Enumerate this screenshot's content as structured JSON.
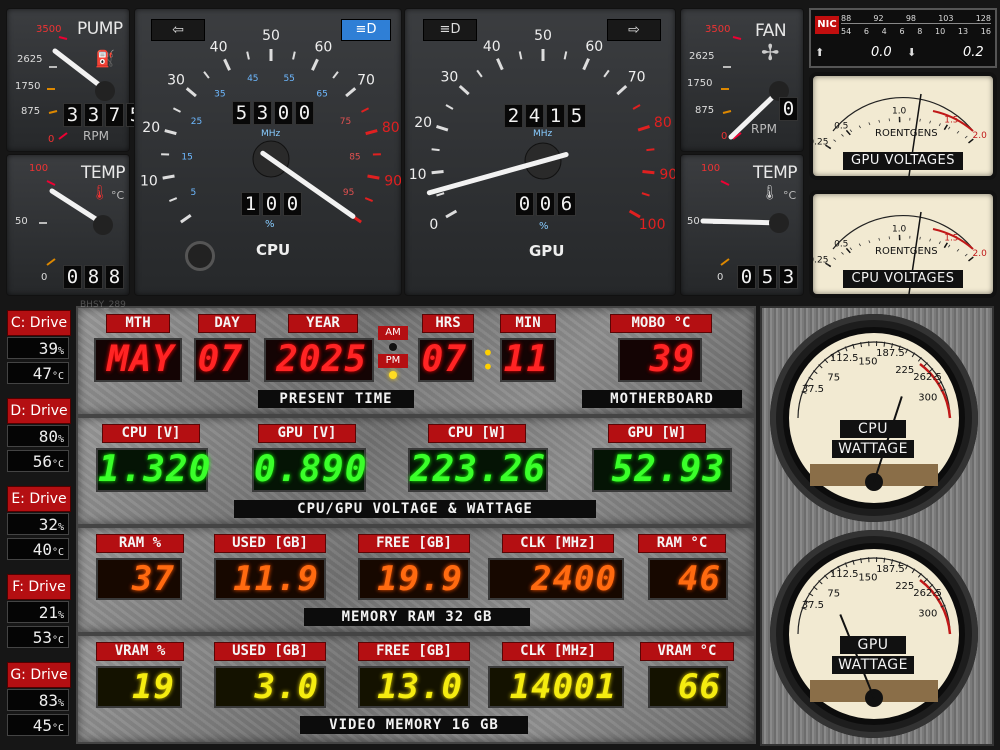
{
  "pump": {
    "title": "PUMP",
    "ticks": [
      "3500",
      "2625",
      "1750",
      "875",
      "0"
    ],
    "value": "3375",
    "unit": "RPM"
  },
  "temp_left": {
    "title": "TEMP",
    "ticks": [
      "100",
      "50",
      "0"
    ],
    "value": "088",
    "unit": "°C"
  },
  "fan": {
    "title": "FAN",
    "ticks": [
      "3500",
      "2625",
      "1750",
      "875",
      "0"
    ],
    "value": "0",
    "unit": "RPM"
  },
  "temp_right": {
    "title": "TEMP",
    "ticks": [
      "100",
      "50",
      "0"
    ],
    "value": "053",
    "unit": "°C"
  },
  "cpu_gauge": {
    "label": "CPU",
    "clock": "5300",
    "clock_unit": "MHz",
    "load": "100",
    "load_unit": "%",
    "outer_ticks": [
      "10",
      "20",
      "30",
      "40",
      "50",
      "60",
      "70",
      "80",
      "90"
    ],
    "inner_ticks": [
      "5",
      "15",
      "25",
      "35",
      "45",
      "55",
      "65",
      "75",
      "85",
      "95"
    ]
  },
  "gpu_gauge": {
    "label": "GPU",
    "clock": "2415",
    "clock_unit": "MHz",
    "load": "006",
    "load_unit": "%",
    "ticks": [
      "0",
      "10",
      "20",
      "30",
      "40",
      "50",
      "60",
      "70",
      "80",
      "90",
      "100"
    ]
  },
  "nic": {
    "label": "NIC",
    "top_scale": [
      "88",
      "92",
      "98",
      "103",
      "128"
    ],
    "bottom_scale": [
      "54",
      "6",
      "4",
      "6",
      "8",
      "10",
      "13",
      "16"
    ],
    "up": "0.0",
    "down": "0.2"
  },
  "gpu_voltages": {
    "label": "GPU VOLTAGES",
    "unit": "ROENTGENS",
    "scale": [
      "0.25",
      "0.5",
      "1.0",
      "1.5",
      "2.0"
    ]
  },
  "cpu_voltages": {
    "label": "CPU VOLTAGES",
    "unit": "ROENTGENS",
    "scale": [
      "0.25",
      "0.5",
      "1.0",
      "1.5",
      "2.0"
    ]
  },
  "time": {
    "labels": {
      "mth": "MTH",
      "day": "DAY",
      "year": "YEAR",
      "hrs": "HRS",
      "min": "MIN",
      "mobo": "MOBO °C",
      "am": "AM",
      "pm": "PM"
    },
    "month": "MAY",
    "day": "07",
    "year": "2025",
    "hrs": "07",
    "min": "11",
    "mobo": "39",
    "banner": "PRESENT TIME",
    "banner2": "MOTHERBOARD"
  },
  "power": {
    "labels": {
      "cpu_v": "CPU [V]",
      "gpu_v": "GPU [V]",
      "cpu_w": "CPU [W]",
      "gpu_w": "GPU [W]"
    },
    "cpu_v": "1.320",
    "gpu_v": "0.890",
    "cpu_w": "223.26",
    "gpu_w": "52.93",
    "banner": "CPU/GPU VOLTAGE & WATTAGE"
  },
  "ram": {
    "labels": {
      "pct": "RAM %",
      "used": "USED [GB]",
      "free": "FREE [GB]",
      "clk": "CLK [MHz]",
      "temp": "RAM °C"
    },
    "pct": "37",
    "used": "11.9",
    "free": "19.9",
    "clk": "2400",
    "temp": "46",
    "banner": "MEMORY RAM 32 GB"
  },
  "vram": {
    "labels": {
      "pct": "VRAM %",
      "used": "USED [GB]",
      "free": "FREE [GB]",
      "clk": "CLK [MHz]",
      "temp": "VRAM °C"
    },
    "pct": "19",
    "used": "3.0",
    "free": "13.0",
    "clk": "14001",
    "temp": "66",
    "banner": "VIDEO MEMORY 16 GB"
  },
  "drives": [
    {
      "label": "C: Drive",
      "pct": "39",
      "temp": "47"
    },
    {
      "label": "D: Drive",
      "pct": "80",
      "temp": "56"
    },
    {
      "label": "E: Drive",
      "pct": "32",
      "temp": "40"
    },
    {
      "label": "F: Drive",
      "pct": "21",
      "temp": "53"
    },
    {
      "label": "G: Drive",
      "pct": "83",
      "temp": "45"
    }
  ],
  "drive_units": {
    "pct": "%",
    "temp": "°C"
  },
  "cpu_wattage": {
    "label1": "CPU",
    "label2": "WATTAGE",
    "scale": [
      "37.5",
      "75",
      "112.5",
      "150",
      "187.5",
      "225",
      "262.5",
      "300"
    ]
  },
  "gpu_wattage": {
    "label1": "GPU",
    "label2": "WATTAGE",
    "scale": [
      "37.5",
      "75",
      "112.5",
      "150",
      "187.5",
      "225",
      "262.5",
      "300"
    ]
  },
  "watermark": "BHSY_289",
  "colors": {
    "accent_red": "#b40f12",
    "lcd_red": "#ff2424",
    "lcd_green": "#3aff2a",
    "lcd_orange": "#ff6a10",
    "lcd_yellow": "#f5ec10",
    "headlight_blue": "#2f7fd6"
  }
}
